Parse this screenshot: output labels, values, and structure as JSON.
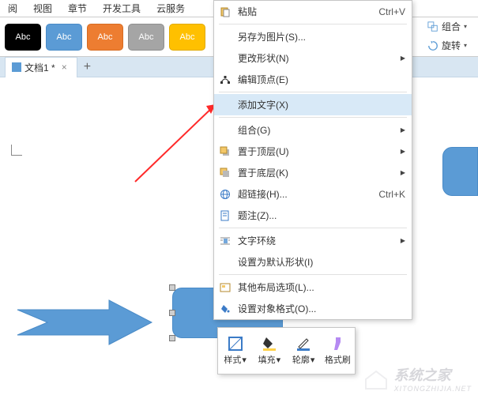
{
  "topmenu": {
    "items": [
      "阅",
      "视图",
      "章节",
      "开发工具",
      "云服务"
    ]
  },
  "shapes": {
    "label": "Abc"
  },
  "tab": {
    "name": "文档1 *",
    "close": "×",
    "add": "+"
  },
  "right_panel": {
    "group": "组合",
    "rotate": "旋转"
  },
  "context_menu": [
    {
      "icon": "paste",
      "label": "粘贴",
      "shortcut": "Ctrl+V"
    },
    {
      "sep": true
    },
    {
      "label": "另存为图片(S)..."
    },
    {
      "label": "更改形状(N)",
      "sub": true
    },
    {
      "icon": "editpoints",
      "label": "编辑顶点(E)"
    },
    {
      "sep": true
    },
    {
      "label": "添加文字(X)",
      "hl": true
    },
    {
      "sep": true
    },
    {
      "label": "组合(G)",
      "sub": true
    },
    {
      "icon": "front",
      "label": "置于顶层(U)",
      "sub": true
    },
    {
      "icon": "back",
      "label": "置于底层(K)",
      "sub": true
    },
    {
      "icon": "globe",
      "label": "超链接(H)...",
      "shortcut": "Ctrl+K"
    },
    {
      "icon": "note",
      "label": "题注(Z)..."
    },
    {
      "sep": true
    },
    {
      "icon": "wrap",
      "label": "文字环绕",
      "sub": true
    },
    {
      "label": "设置为默认形状(I)"
    },
    {
      "sep": true
    },
    {
      "icon": "layout",
      "label": "其他布局选项(L)..."
    },
    {
      "icon": "format",
      "label": "设置对象格式(O)..."
    }
  ],
  "mini_toolbar": [
    {
      "label": "样式",
      "drop": true
    },
    {
      "label": "填充",
      "drop": true
    },
    {
      "label": "轮廓",
      "drop": true
    },
    {
      "label": "格式刷"
    }
  ],
  "watermark": {
    "text": "系统之家",
    "url": "XITONGZHIJIA.NET"
  }
}
